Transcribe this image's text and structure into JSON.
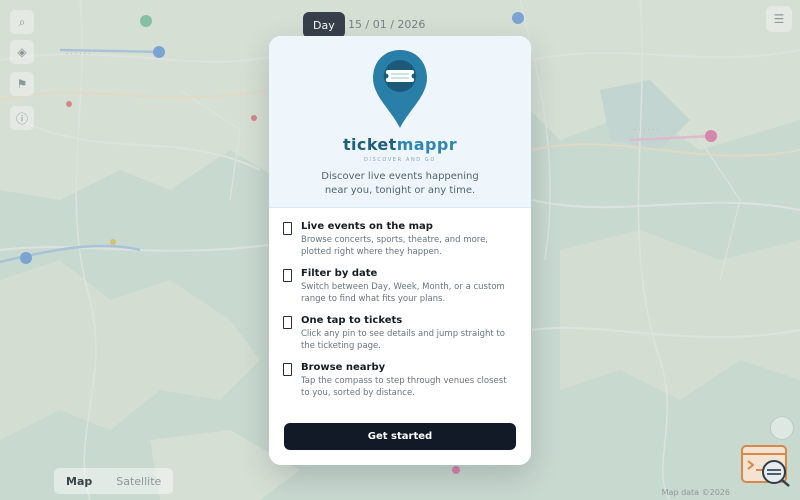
{
  "map": {
    "top_chip": "Day",
    "top_date": "15 / 01 / 2026",
    "map_type": {
      "map_label": "Map",
      "satellite_label": "Satellite"
    },
    "attribution": "Map data ©2026"
  },
  "onboarding": {
    "brand_part1": "ticket",
    "brand_part2": "mappr",
    "tagline": "DISCOVER AND GO",
    "subtitle": "Discover live events happening near you, tonight or any time.",
    "features": [
      {
        "title": "Live events on the map",
        "desc": "Browse concerts, sports, theatre, and more, plotted right where they happen."
      },
      {
        "title": "Filter by date",
        "desc": "Switch between Day, Week, Month, or a custom range to find what fits your plans."
      },
      {
        "title": "One tap to tickets",
        "desc": "Click any pin to see details and jump straight to the ticketing page."
      },
      {
        "title": "Browse nearby",
        "desc": "Tap the compass to step through venues closest to you, sorted by distance."
      }
    ],
    "cta_label": "Get started"
  },
  "colors": {
    "cta": "#121a27",
    "brand_dark": "#1f5f7e",
    "brand_light": "#2e86b3",
    "pin": "#2a7fa8"
  }
}
